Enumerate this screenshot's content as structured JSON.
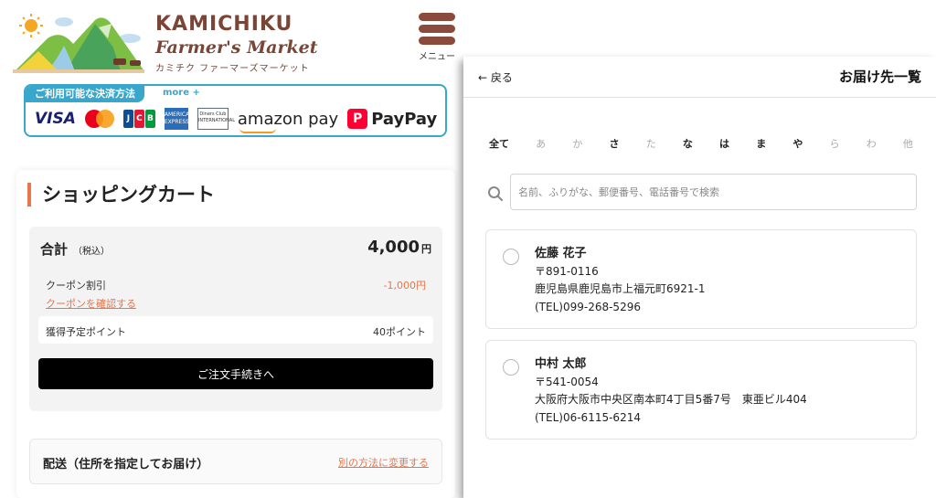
{
  "store": {
    "brand_line1": "KAMICHIKU",
    "brand_line2": "Farmer's Market",
    "brand_kana": "カミチク ファーマーズマーケット",
    "menu_label": "メニュー"
  },
  "payment": {
    "heading": "ご利用可能な決済方法",
    "more": "more +",
    "methods": {
      "visa": "VISA",
      "jcb": [
        "J",
        "C",
        "B"
      ],
      "amex": "AMERICAN EXPRESS",
      "diners": "Diners Club INTERNATIONAL",
      "amazon": "amazon pay",
      "paypay_mark": "P",
      "paypay": "PayPay"
    }
  },
  "cart": {
    "title": "ショッピングカート",
    "total_label": "合計",
    "tax_note": "（税込）",
    "total_amount": "4,000",
    "currency": "円",
    "coupon_label": "クーポン割引",
    "coupon_value": "-1,000円",
    "coupon_link": "クーポンを確認する",
    "points_label": "獲得予定ポイント",
    "points_value": "40ポイント",
    "checkout_button": "ご注文手続きへ",
    "delivery_title": "配送（住所を指定してお届け）",
    "delivery_change": "別の方法に変更する"
  },
  "address_panel": {
    "back": "← 戻る",
    "title": "お届け先一覧",
    "kana_filters": [
      {
        "label": "全て",
        "enabled": true
      },
      {
        "label": "あ",
        "enabled": false
      },
      {
        "label": "か",
        "enabled": false
      },
      {
        "label": "さ",
        "enabled": true
      },
      {
        "label": "た",
        "enabled": false
      },
      {
        "label": "な",
        "enabled": true
      },
      {
        "label": "は",
        "enabled": true
      },
      {
        "label": "ま",
        "enabled": true
      },
      {
        "label": "や",
        "enabled": true
      },
      {
        "label": "ら",
        "enabled": false
      },
      {
        "label": "わ",
        "enabled": false
      },
      {
        "label": "他",
        "enabled": false
      }
    ],
    "search_placeholder": "名前、ふりがな、郵便番号、電話番号で検索",
    "addresses": [
      {
        "name": "佐藤 花子",
        "postal": "〒891-0116",
        "address": "鹿児島県鹿児島市上福元町6921-1",
        "tel": "(TEL)099-268-5296"
      },
      {
        "name": "中村 太郎",
        "postal": "〒541-0054",
        "address": "大阪府大阪市中央区南本町4丁目5番7号　東亜ビル404",
        "tel": "(TEL)06-6115-6214"
      }
    ]
  },
  "colors": {
    "accent_orange": "#e8754c",
    "brand_brown": "#7a4535",
    "payment_blue": "#39a7cc",
    "checkout_black": "#000000"
  },
  "icons": [
    "logo-illustration",
    "menu-icon",
    "search-icon",
    "radio-icon"
  ]
}
